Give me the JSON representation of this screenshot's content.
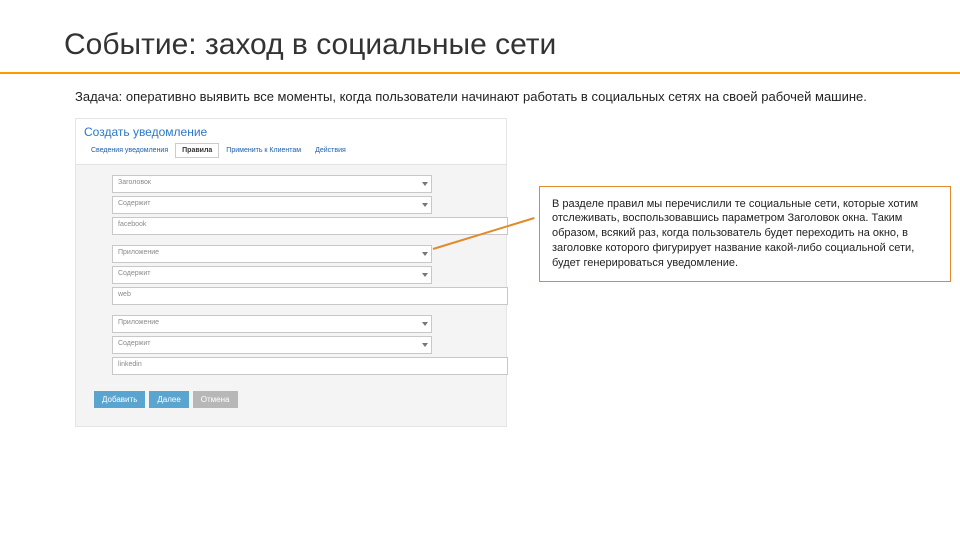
{
  "title": "Событие: заход в социальные сети",
  "task": "Задача: оперативно выявить все моменты, когда пользователи начинают работать в социальных сетях на своей рабочей машине.",
  "callout": "В разделе правил мы перечислили те социальные сети, которые хотим отслеживать, воспользовавшись параметром Заголовок окна. Таким образом, всякий раз, когда пользователь будет переходить на окно, в заголовке которого фигурирует название какой-либо социальной сети, будет генерироваться уведомление.",
  "shot": {
    "heading": "Создать уведомление",
    "tabs": [
      "Сведения уведомления",
      "Правила",
      "Применить к Клиентам",
      "Действия"
    ],
    "active_tab": 1,
    "rules": [
      {
        "attr": "Заголовок",
        "op": "Содержит",
        "val": "facebook"
      },
      {
        "attr": "Приложение",
        "op": "Содержит",
        "val": "web"
      },
      {
        "attr": "Приложение",
        "op": "Содержит",
        "val": "linkedin"
      }
    ],
    "buttons": [
      "Добавить",
      "Далее",
      "Отмена"
    ]
  }
}
